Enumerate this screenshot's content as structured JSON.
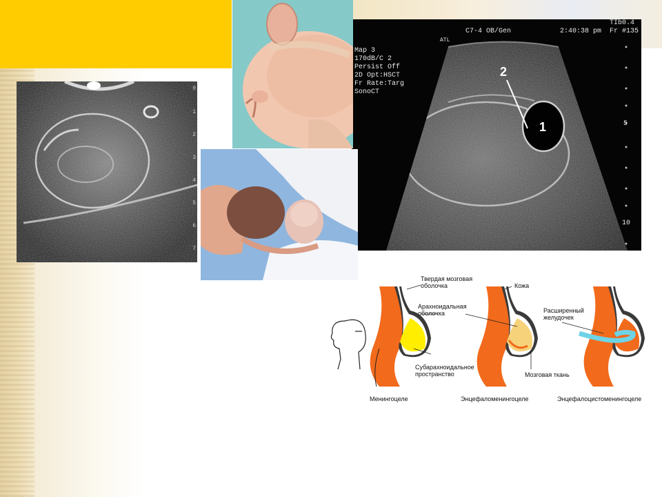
{
  "ultrasound_right": {
    "header_probe": "C7-4 OB/Gen",
    "header_time": "2:40:38 pm",
    "header_ti": "TIb0.4",
    "header_frame": "Fr #135",
    "badge_atl": "ATL",
    "settings": [
      "Map 3",
      "170dB/C 2",
      "Persist Off",
      "2D Opt:HSCT",
      "Fr Rate:Targ",
      "SonoCT"
    ],
    "depth_marks": [
      "5",
      "10"
    ],
    "label_1": "1",
    "label_2": "2"
  },
  "ultrasound_left": {
    "depth_marks": [
      "0",
      "1",
      "2",
      "3",
      "4",
      "5",
      "6",
      "7"
    ]
  },
  "diagram": {
    "labels": {
      "dura": "Твердая мозговая\nоболочка",
      "skin": "Кожа",
      "arachnoid": "Арахноидальная\nоболочка",
      "subarachnoid": "Субарахноидальное\nпространство",
      "brain_tissue": "Мозговая ткань",
      "ventricle": "Расширенный\nжелудочек"
    },
    "captions": [
      "Менингоцеле",
      "Энцефаломенингоцеле",
      "Энцефалоцистоменингоцеле"
    ],
    "colors": {
      "bone": "#f26a1b",
      "csf": "#ffee00",
      "brain": "#f6d27a",
      "ventricle": "#6fd3e6"
    }
  }
}
